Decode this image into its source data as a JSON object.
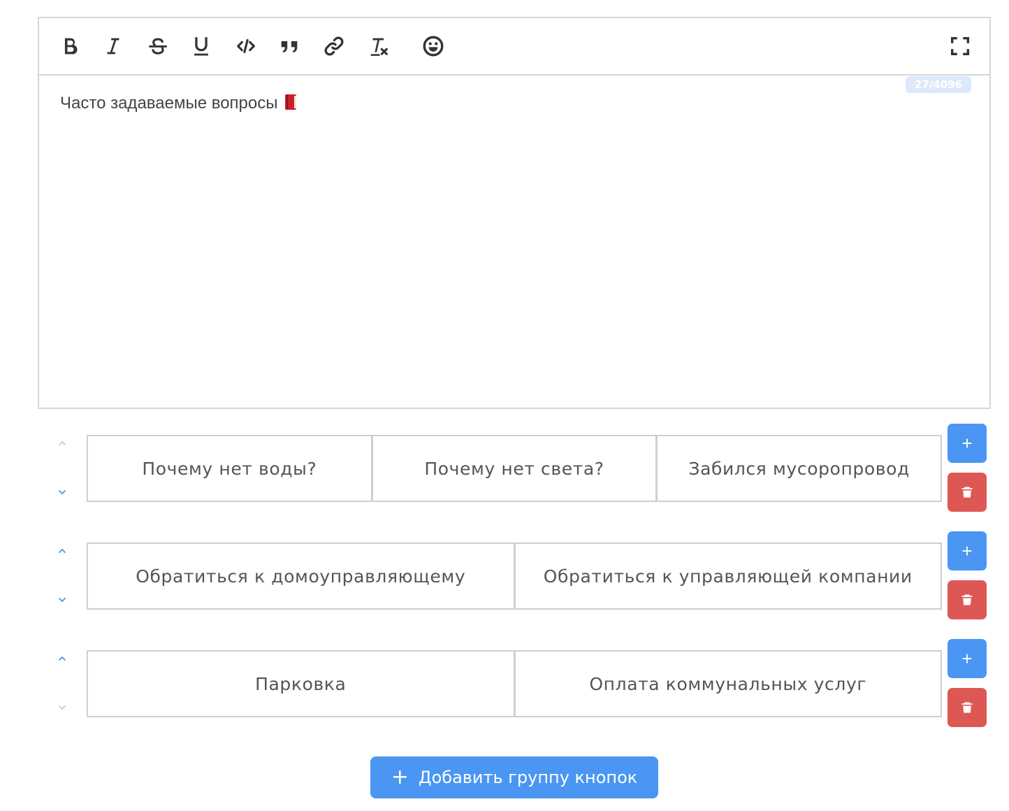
{
  "editor": {
    "toolbar": [
      {
        "name": "bold-button",
        "icon": "bold-icon"
      },
      {
        "name": "italic-button",
        "icon": "italic-icon"
      },
      {
        "name": "strikethrough-button",
        "icon": "strikethrough-icon"
      },
      {
        "name": "underline-button",
        "icon": "underline-icon"
      },
      {
        "name": "code-button",
        "icon": "code-icon"
      },
      {
        "name": "quote-button",
        "icon": "quote-icon"
      },
      {
        "name": "link-button",
        "icon": "link-icon"
      },
      {
        "name": "clear-format-button",
        "icon": "clear-format-icon"
      },
      {
        "name": "emoji-button",
        "icon": "emoji-icon"
      },
      {
        "name": "fullscreen-button",
        "icon": "fullscreen-icon"
      }
    ],
    "counter": "27/4096",
    "content": "Часто задаваемые вопросы",
    "content_emoji": "book-icon"
  },
  "button_groups": [
    {
      "up_enabled": false,
      "down_enabled": true,
      "buttons": [
        "Почему нет воды?",
        "Почему нет света?",
        "Забился мусоропровод"
      ]
    },
    {
      "up_enabled": true,
      "down_enabled": true,
      "buttons": [
        "Обратиться к домоуправляющему",
        "Обратиться к управляющей компании"
      ]
    },
    {
      "up_enabled": true,
      "down_enabled": false,
      "buttons": [
        "Парковка",
        "Оплата коммунальных услуг"
      ]
    }
  ],
  "side_buttons": {
    "add_label": "+",
    "delete_icon": "trash-icon"
  },
  "add_group_button": {
    "plus": "+",
    "label": "Добавить группу кнопок"
  },
  "colors": {
    "accent": "#4a96f2",
    "danger": "#dd5855",
    "border": "#d6d6d6",
    "arrow_enabled": "#4a96f2",
    "arrow_disabled": "#c9c9c9"
  }
}
